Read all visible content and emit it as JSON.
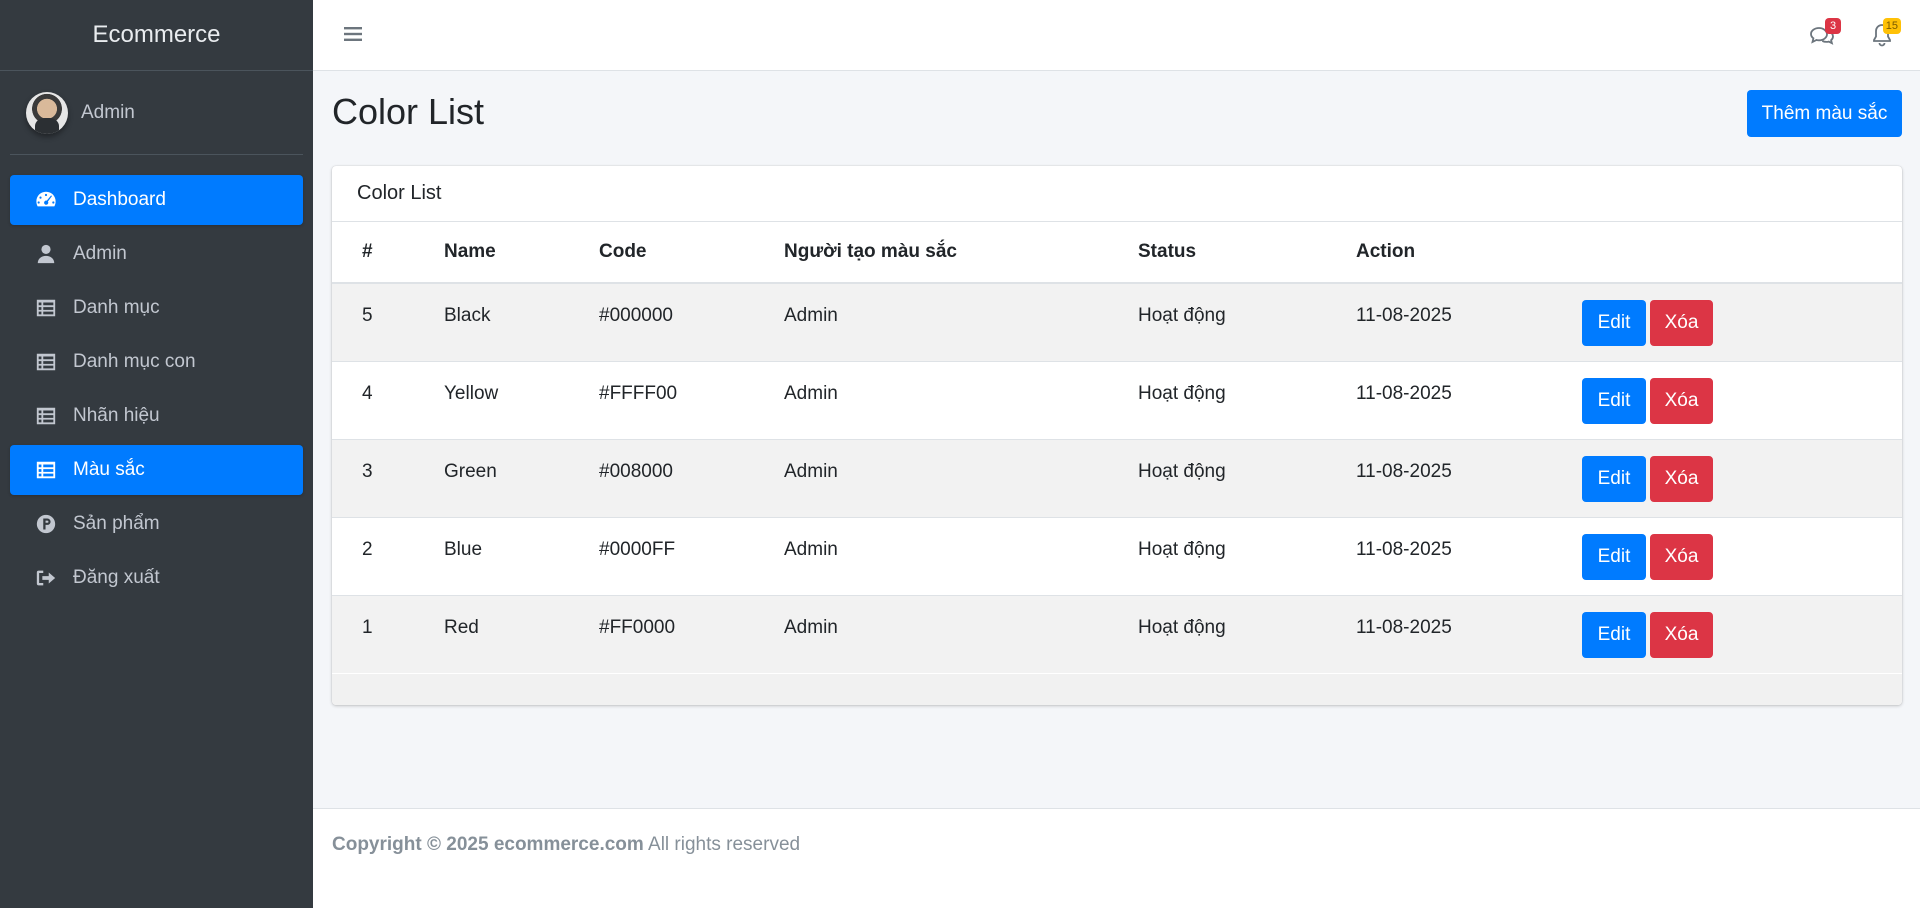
{
  "sidebar": {
    "brand": "Ecommerce",
    "user_name": "Admin",
    "items": [
      {
        "label": "Dashboard",
        "icon": "dashboard-gauge-icon",
        "active": true
      },
      {
        "label": "Admin",
        "icon": "user-icon",
        "active": false
      },
      {
        "label": "Danh mục",
        "icon": "list-icon",
        "active": false
      },
      {
        "label": "Danh mục con",
        "icon": "list-icon",
        "active": false
      },
      {
        "label": "Nhãn hiệu",
        "icon": "list-icon",
        "active": false
      },
      {
        "label": "Màu sắc",
        "icon": "list-icon",
        "active": true
      },
      {
        "label": "Sản phẩm",
        "icon": "product-p-icon",
        "active": false
      },
      {
        "label": "Đăng xuất",
        "icon": "sign-out-icon",
        "active": false
      }
    ]
  },
  "navbar": {
    "messages_badge": "3",
    "notifications_badge": "15"
  },
  "main": {
    "title": "Color List",
    "add_button": "Thêm màu sắc",
    "card_title": "Color List",
    "columns": [
      "#",
      "Name",
      "Code",
      "Người tạo màu sắc",
      "Status",
      "Action"
    ],
    "rows": [
      {
        "id": "5",
        "name": "Black",
        "code": "#000000",
        "creator": "Admin",
        "status": "Hoạt động",
        "date": "11-08-2025"
      },
      {
        "id": "4",
        "name": "Yellow",
        "code": "#FFFF00",
        "creator": "Admin",
        "status": "Hoạt động",
        "date": "11-08-2025"
      },
      {
        "id": "3",
        "name": "Green",
        "code": "#008000",
        "creator": "Admin",
        "status": "Hoạt động",
        "date": "11-08-2025"
      },
      {
        "id": "2",
        "name": "Blue",
        "code": "#0000FF",
        "creator": "Admin",
        "status": "Hoạt động",
        "date": "11-08-2025"
      },
      {
        "id": "1",
        "name": "Red",
        "code": "#FF0000",
        "creator": "Admin",
        "status": "Hoạt động",
        "date": "11-08-2025"
      }
    ],
    "edit_label": "Edit",
    "delete_label": "Xóa"
  },
  "footer": {
    "copyright": "Copyright © 2025 ecommerce.com",
    "rights": "All rights reserved"
  },
  "colors": {
    "primary": "#007bff",
    "danger": "#dc3545",
    "sidebar_bg": "#343a40",
    "warning": "#ffc107"
  }
}
